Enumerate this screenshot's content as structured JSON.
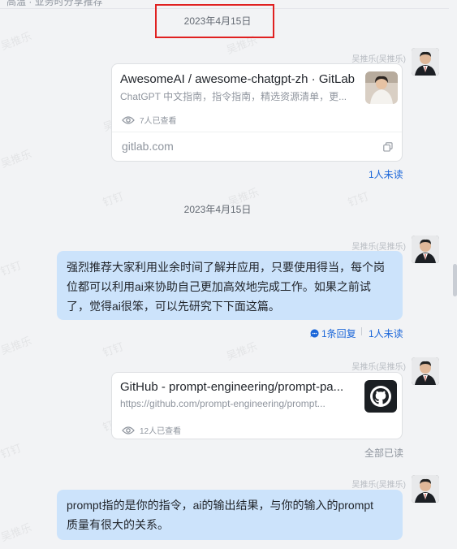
{
  "header": {
    "partial_text": "高温 · 业务时分享推荐"
  },
  "watermarks": [
    "吴推乐",
    "钉钉"
  ],
  "messages": [
    {
      "date": "2023年4月15日",
      "sender": "吴推乐(吴推乐)",
      "card": {
        "title": "AwesomeAI / awesome-chatgpt-zh · GitLab",
        "subtitle": "ChatGPT 中文指南，指令指南，精选资源清单，更...",
        "views": "7人已查看",
        "domain": "gitlab.com"
      },
      "status": "1人未读"
    },
    {
      "date": "2023年4月15日",
      "sender": "吴推乐(吴推乐)",
      "text_lines": [
        "强烈推荐大家利用业余时间了解并应用，只要使用得当，每个岗",
        "位都可以利用ai来协助自己更加高效地完成工作。如果之前试",
        "了，觉得ai很笨，可以先研究下下面这篇。"
      ],
      "reply": "1条回复",
      "status": "1人未读"
    },
    {
      "sender": "吴推乐(吴推乐)",
      "card": {
        "title": "GitHub - prompt-engineering/prompt-pa...",
        "subtitle": "https://github.com/prompt-engineering/prompt...",
        "views": "12人已查看"
      },
      "status": "全部已读"
    },
    {
      "sender": "吴推乐(吴推乐)",
      "text_lines": [
        "prompt指的是你的指令，ai的输出结果，与你的输入的prompt",
        "质量有很大的关系。"
      ]
    }
  ],
  "colors": {
    "bubble": "#cce3fb",
    "link_status": "#1b66d9",
    "highlight_box": "#e02020"
  },
  "icons": [
    "eye-icon",
    "copy-icon",
    "reply-icon",
    "github-icon",
    "avatar"
  ]
}
